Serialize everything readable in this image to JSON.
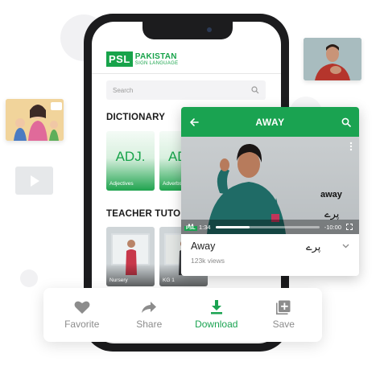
{
  "app": {
    "logo_mark": "PSL",
    "logo_line1": "PAKISTAN",
    "logo_line2": "SIGN LANGUAGE"
  },
  "search": {
    "placeholder": "Search"
  },
  "dictionary": {
    "title": "DICTIONARY",
    "cards": [
      {
        "abbr": "ADJ.",
        "label": "Adjectives"
      },
      {
        "abbr": "ADV.",
        "label": "Adverbs"
      }
    ]
  },
  "tutorials": {
    "title": "TEACHER TUTORIALS",
    "cards": [
      {
        "label": "Nursery"
      },
      {
        "label": "KG 1"
      }
    ]
  },
  "video": {
    "header_title": "AWAY",
    "word_overlay": "away",
    "urdu_overlay": "پرے",
    "current_time": "1:34",
    "total_time": "-10:00",
    "progress": 0.33,
    "badge": "PSL",
    "name": "Away",
    "urdu_name": "پرے",
    "views": "123k views"
  },
  "actions": [
    {
      "label": "Favorite",
      "icon": "heart-icon",
      "active": false
    },
    {
      "label": "Share",
      "icon": "share-icon",
      "active": false
    },
    {
      "label": "Download",
      "icon": "download-icon",
      "active": true
    },
    {
      "label": "Save",
      "icon": "save-icon",
      "active": false
    }
  ],
  "colors": {
    "brand_green": "#1aa351",
    "inactive_gray": "#8c8c8c"
  }
}
